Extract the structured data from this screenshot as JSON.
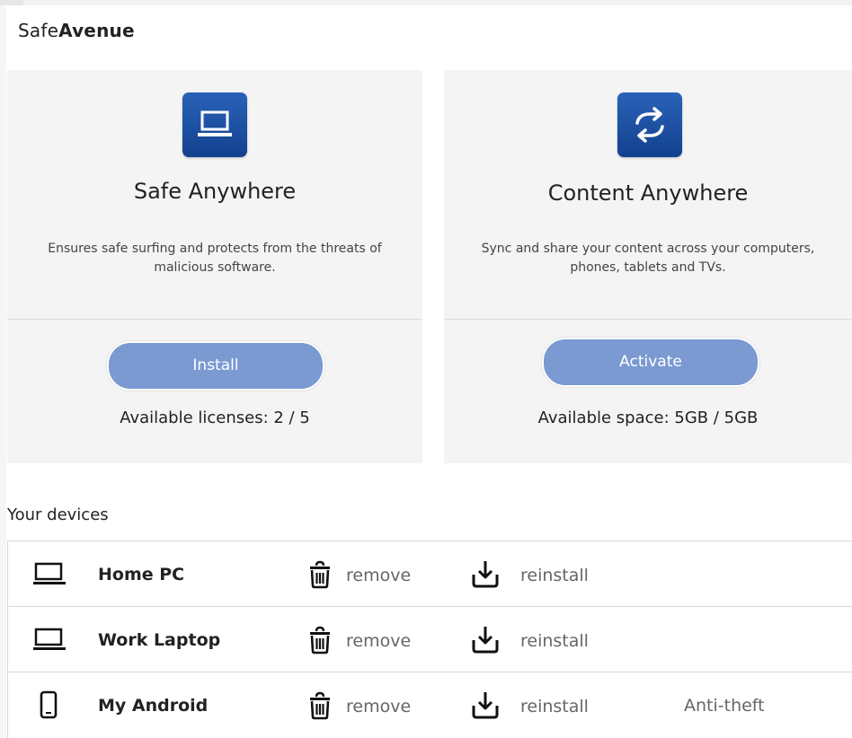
{
  "brand": {
    "name_light": "Safe",
    "name_bold": "Avenue"
  },
  "products": [
    {
      "icon": "laptop-icon",
      "title": "Safe Anywhere",
      "description": "Ensures safe surfing and protects from the threats of malicious software.",
      "action_label": "Install",
      "meta": "Available licenses: 2 / 5"
    },
    {
      "icon": "sync-icon",
      "title": "Content Anywhere",
      "description": "Sync and share your content across your computers, phones, tablets and TVs.",
      "action_label": "Activate",
      "meta": "Available space: 5GB / 5GB"
    }
  ],
  "devices": {
    "heading": "Your devices",
    "items": [
      {
        "icon": "laptop-icon",
        "name": "Home PC",
        "remove_label": "remove",
        "reinstall_label": "reinstall",
        "extra_label": ""
      },
      {
        "icon": "laptop-icon",
        "name": "Work Laptop",
        "remove_label": "remove",
        "reinstall_label": "reinstall",
        "extra_label": ""
      },
      {
        "icon": "phone-icon",
        "name": "My Android",
        "remove_label": "remove",
        "reinstall_label": "reinstall",
        "extra_label": "Anti-theft"
      }
    ]
  },
  "colors": {
    "accent_button": "#7b9ad2",
    "icon_tile": "#1f56a8",
    "card_background": "#f4f4f4"
  }
}
